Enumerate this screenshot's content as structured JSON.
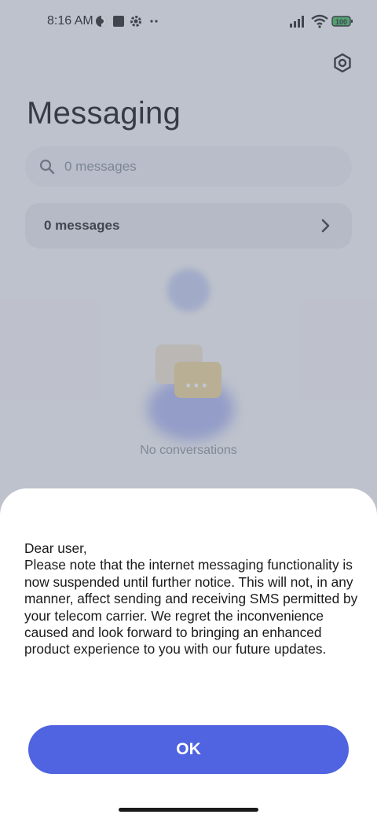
{
  "status_bar": {
    "time": "8:16 AM",
    "battery": "100",
    "icons": [
      "vpn-icon",
      "square-icon",
      "settings-gear-icon",
      "more-dots-icon",
      "signal-icon",
      "wifi-icon",
      "battery-icon"
    ]
  },
  "header": {
    "title": "Messaging",
    "settings_icon": "settings-icon"
  },
  "search": {
    "placeholder": "0 messages"
  },
  "messages_row": {
    "label": "0 messages"
  },
  "empty_state": {
    "text": "No conversations",
    "dots": "•••"
  },
  "dialog": {
    "message": "Dear user,\nPlease note that the internet messaging functionality is now suspended until further notice. This will not, in any manner, affect sending and receiving SMS permitted by your telecom carrier. We regret the inconvenience caused and look forward to bringing an enhanced product experience to you with our future updates.",
    "ok_label": "OK"
  },
  "colors": {
    "accent": "#5063e0",
    "overlay": "#6e768c"
  }
}
